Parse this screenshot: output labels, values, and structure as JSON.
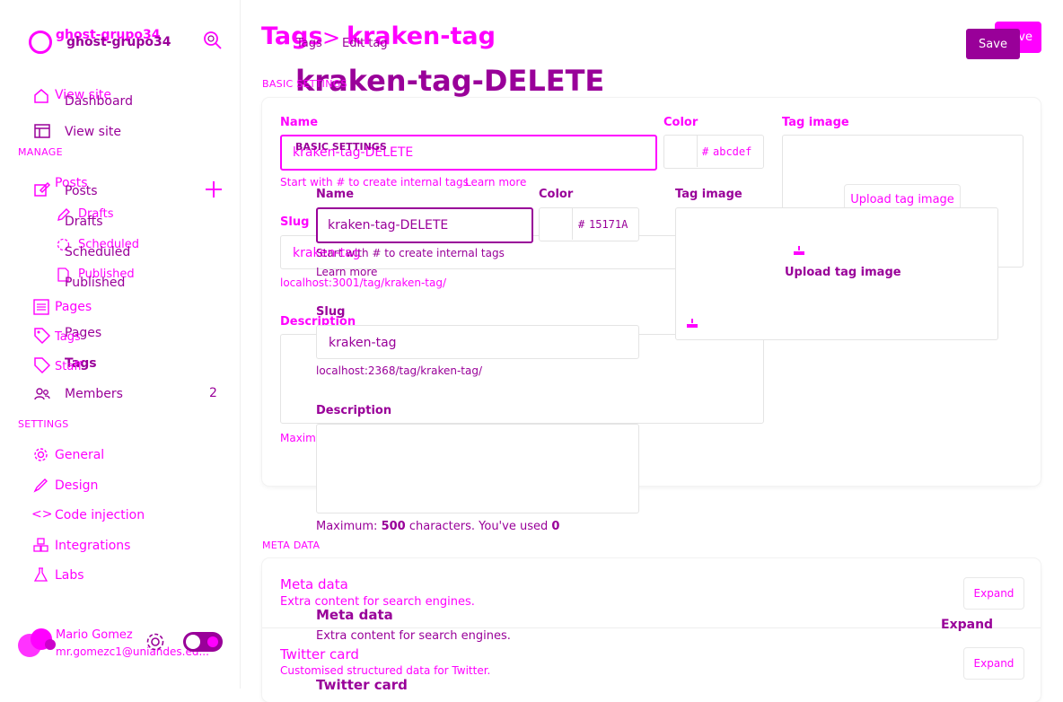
{
  "sidebar": {
    "site_name_a": "ghost-grupo34",
    "site_name_b": "ghost-grupo34",
    "nav": {
      "view_site_a": "View site",
      "dashboard": "Dashboard",
      "view_site": "View site",
      "manage_heading": "MANAGE",
      "posts_a": "Posts",
      "posts_b": "Posts",
      "drafts_a": "Drafts",
      "drafts_b": "Drafts",
      "scheduled_a": "Scheduled",
      "scheduled_b": "Scheduled",
      "published_a": "Published",
      "published_b": "Published",
      "pages_a": "Pages",
      "pages_b": "Pages",
      "tags_a": "Tags",
      "tags_b": "Tags",
      "staff": "Staff",
      "members": "Members",
      "members_count": "2",
      "settings_heading": "SETTINGS",
      "general": "General",
      "design": "Design",
      "code_injection": "Code injection",
      "integrations": "Integrations",
      "labs": "Labs"
    },
    "user": {
      "name": "Mario Gomez",
      "email": "mr.gomezc1@uniandes.ed..."
    }
  },
  "header": {
    "breadcrumb_root": "Tags",
    "breadcrumb_sep": ">",
    "breadcrumb_current": "kraken-tag",
    "breadcrumb_root_b": "Tags",
    "breadcrumb_current_b": "Edit tag",
    "title": "kraken-tag-DELETE",
    "save_a": "Save",
    "save_b": "Save"
  },
  "basic": {
    "heading_a": "BASIC SETTINGS",
    "heading_b": "BASIC SETTINGS",
    "name_label_a": "Name",
    "name_label_b": "Name",
    "name_value_a": "kraken-tag-DELETE",
    "name_value_b": "kraken-tag-DELETE",
    "name_hint_a": "Start with # to create internal tags",
    "learn_more_a": "Learn more",
    "name_hint_b": "Start with # to create internal tags",
    "learn_more_b": "Learn more",
    "color_label_a": "Color",
    "color_label_b": "Color",
    "color_value_a": "abcdef",
    "color_value_b": "15171A",
    "hash": "#",
    "slug_label_a": "Slug",
    "slug_label_b": "Slug",
    "slug_value_a": "kraken-tag",
    "slug_value_b": "kraken-tag",
    "slug_url_a": "localhost:3001/tag/kraken-tag/",
    "slug_url_b": "localhost:2368/tag/kraken-tag/",
    "description_label_a": "Description",
    "description_label_b": "Description",
    "max_prefix": "Maximum:",
    "max_value": "500",
    "max_middle": "characters. You've used",
    "used_value": "0",
    "image_label_a": "Tag image",
    "image_label_b": "Tag image",
    "upload_a": "Upload tag image",
    "upload_b": "Upload tag image"
  },
  "meta": {
    "heading": "META DATA",
    "meta_title_a": "Meta data",
    "meta_desc_a": "Extra content for search engines.",
    "meta_title_b": "Meta data",
    "meta_desc_b": "Extra content for search engines.",
    "expand": "Expand",
    "twitter_title_a": "Twitter card",
    "twitter_desc_a": "Customised structured data for Twitter.",
    "twitter_title_b": "Twitter card"
  },
  "colors": {
    "accent": "#ff00ff",
    "accent_dark": "#990099"
  }
}
